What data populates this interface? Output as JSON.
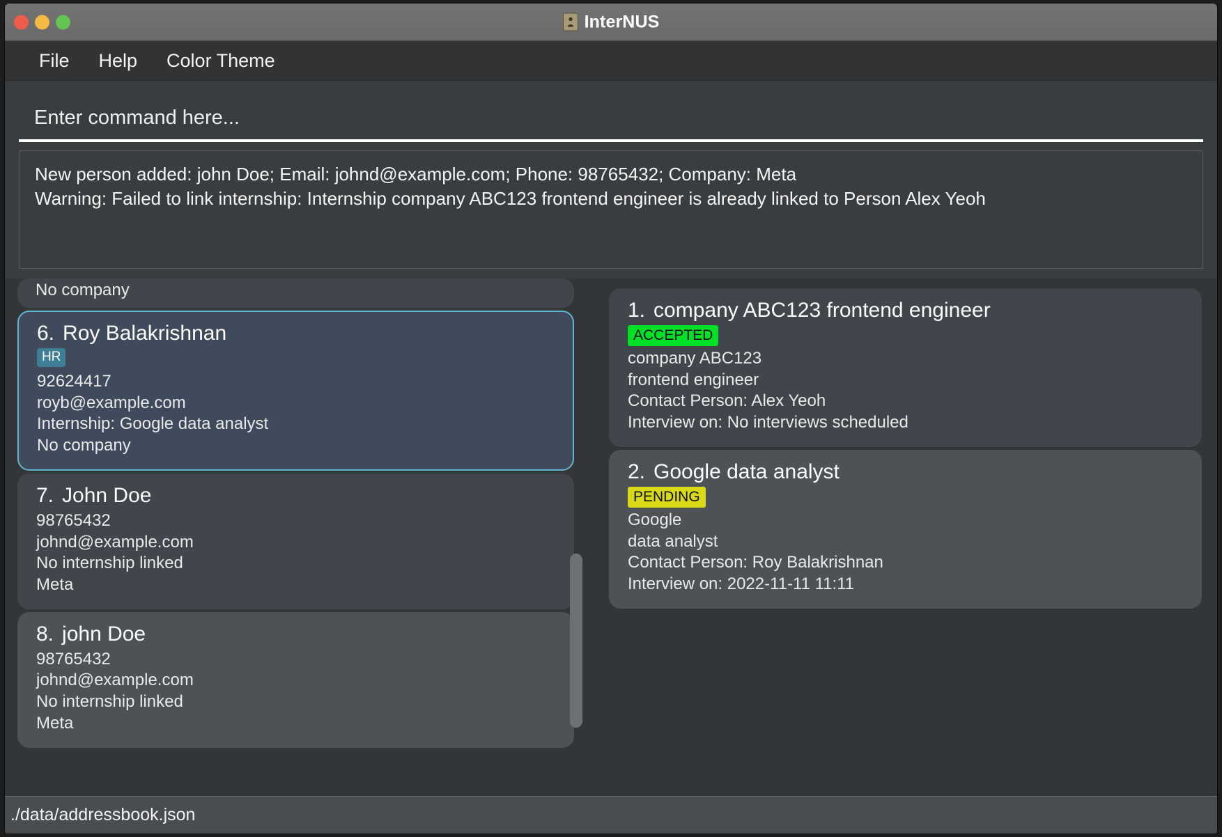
{
  "window": {
    "title": "InterNUS",
    "icon": "person-card-icon",
    "traffic_lights": [
      {
        "name": "close",
        "color": "#f05c4c"
      },
      {
        "name": "minimize",
        "color": "#f3b942"
      },
      {
        "name": "zoom",
        "color": "#62c451"
      }
    ]
  },
  "menubar": {
    "items": [
      {
        "label": "File"
      },
      {
        "label": "Help"
      },
      {
        "label": "Color Theme"
      }
    ]
  },
  "command": {
    "value": "",
    "placeholder": "Enter command here..."
  },
  "result": {
    "lines": [
      "New person added: john Doe; Email: johnd@example.com; Phone: 98765432; Company: Meta",
      "Warning: Failed to link internship: Internship company ABC123 frontend engineer is already linked to Person Alex Yeoh"
    ]
  },
  "persons": {
    "clipped_top": {
      "company": "No company"
    },
    "cards": [
      {
        "index": "6.",
        "name": "Roy Balakrishnan",
        "tag": "HR",
        "phone": "92624417",
        "email": "royb@example.com",
        "internship": "Internship: Google data analyst",
        "company": "No company",
        "state": "selected"
      },
      {
        "index": "7.",
        "name": "John Doe",
        "tag": "",
        "phone": "98765432",
        "email": "johnd@example.com",
        "internship": "No internship linked",
        "company": "Meta",
        "state": "normal"
      },
      {
        "index": "8.",
        "name": "john Doe",
        "tag": "",
        "phone": "98765432",
        "email": "johnd@example.com",
        "internship": "No internship linked",
        "company": "Meta",
        "state": "hover"
      }
    ]
  },
  "internships": {
    "cards": [
      {
        "index": "1.",
        "title": "company ABC123 frontend engineer",
        "status": "ACCEPTED",
        "status_kind": "accepted",
        "company": "company ABC123",
        "role": "frontend engineer",
        "contact": "Contact Person: Alex Yeoh",
        "interview": "Interview on: No interviews scheduled",
        "state": "normal"
      },
      {
        "index": "2.",
        "title": "Google data analyst",
        "status": "PENDING",
        "status_kind": "pending",
        "company": "Google",
        "role": "data analyst",
        "contact": "Contact Person: Roy Balakrishnan",
        "interview": "Interview on: 2022-11-11 11:11",
        "state": "hover"
      }
    ]
  },
  "statusbar": {
    "path": "./data/addressbook.json"
  },
  "colors": {
    "accent_selected_border": "#5fb6cd",
    "tag_hr": "#3f7f96",
    "status_accepted": "#00e024",
    "status_pending": "#d9d916",
    "card_bg": "#40464b",
    "card_bg_hover": "#4d5257",
    "card_bg_selected": "#3f4b5c"
  }
}
